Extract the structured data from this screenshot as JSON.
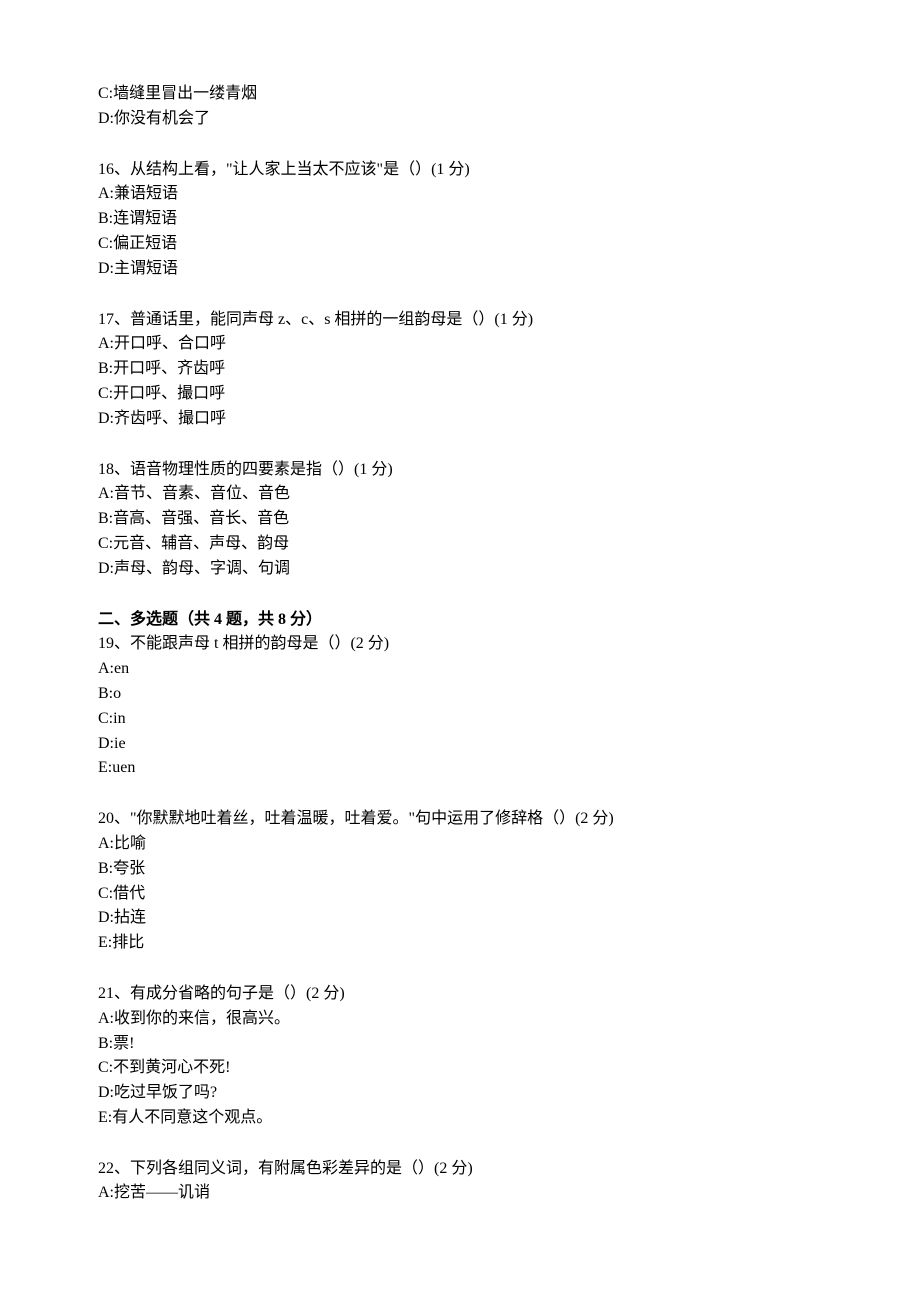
{
  "partial_options": [
    "C:墙缝里冒出一缕青烟",
    "D:你没有机会了"
  ],
  "questions_single": [
    {
      "stem": "16、从结构上看，\"让人家上当太不应该\"是（）(1 分)",
      "options": [
        "A:兼语短语",
        "B:连谓短语",
        "C:偏正短语",
        "D:主谓短语"
      ]
    },
    {
      "stem": "17、普通话里，能同声母 z、c、s 相拼的一组韵母是（）(1 分)",
      "options": [
        "A:开口呼、合口呼",
        "B:开口呼、齐齿呼",
        "C:开口呼、撮口呼",
        "D:齐齿呼、撮口呼"
      ]
    },
    {
      "stem": "18、语音物理性质的四要素是指（）(1 分)",
      "options": [
        "A:音节、音素、音位、音色",
        "B:音高、音强、音长、音色",
        "C:元音、辅音、声母、韵母",
        "D:声母、韵母、字调、句调"
      ]
    }
  ],
  "section_multi_title": "二、多选题（共 4 题，共 8 分）",
  "questions_multi": [
    {
      "stem": "19、不能跟声母 t 相拼的韵母是（）(2 分)",
      "options": [
        "A:en",
        "B:o",
        "C:in",
        "D:ie",
        "E:uen"
      ]
    },
    {
      "stem": "20、\"你默默地吐着丝，吐着温暖，吐着爱。\"句中运用了修辞格（）(2 分)",
      "options": [
        "A:比喻",
        "B:夸张",
        "C:借代",
        "D:拈连",
        "E:排比"
      ]
    },
    {
      "stem": "21、有成分省略的句子是（）(2 分)",
      "options": [
        "A:收到你的来信，很高兴。",
        "B:票!",
        "C:不到黄河心不死!",
        "D:吃过早饭了吗?",
        "E:有人不同意这个观点。"
      ]
    },
    {
      "stem": "22、下列各组同义词，有附属色彩差异的是（）(2 分)",
      "options": [
        "A:挖苦——讥诮"
      ]
    }
  ]
}
